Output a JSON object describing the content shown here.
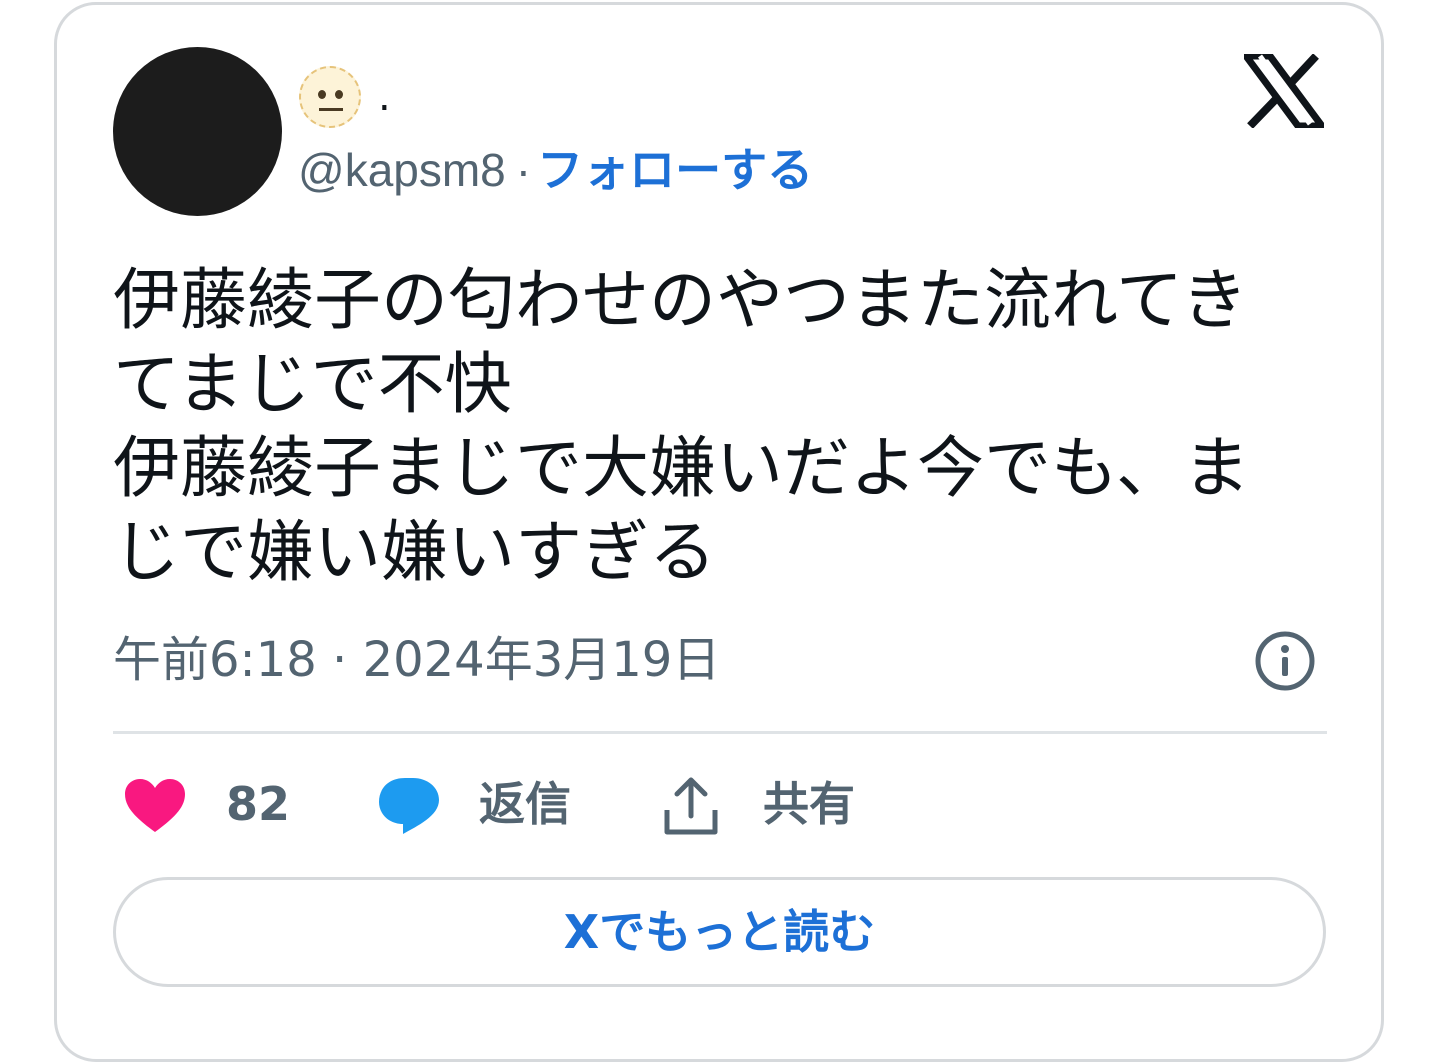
{
  "author": {
    "display_name": ".",
    "handle": "@kapsm8",
    "separator": "·",
    "follow_label": "フォローする",
    "emoji_icon": "neutral-face-emoji"
  },
  "tweet": {
    "lines": [
      "伊藤綾子の匂わせのやつまた流れてき",
      "てまじで不快",
      "伊藤綾子まじで大嫌いだよ今でも、ま",
      "じで嫌い嫌いすぎる"
    ],
    "timestamp": "午前6:18 · 2024年3月19日"
  },
  "actions": {
    "like_count": "82",
    "reply_label": "返信",
    "share_label": "共有"
  },
  "read_more_label": "Xでもっと読む",
  "colors": {
    "like": "#f91880",
    "reply": "#1d9bf0",
    "link": "#1d70d6",
    "muted": "#536471",
    "text": "#0f1419"
  },
  "icons": [
    "x-logo-icon",
    "info-icon",
    "heart-icon",
    "reply-bubble-icon",
    "share-icon"
  ]
}
